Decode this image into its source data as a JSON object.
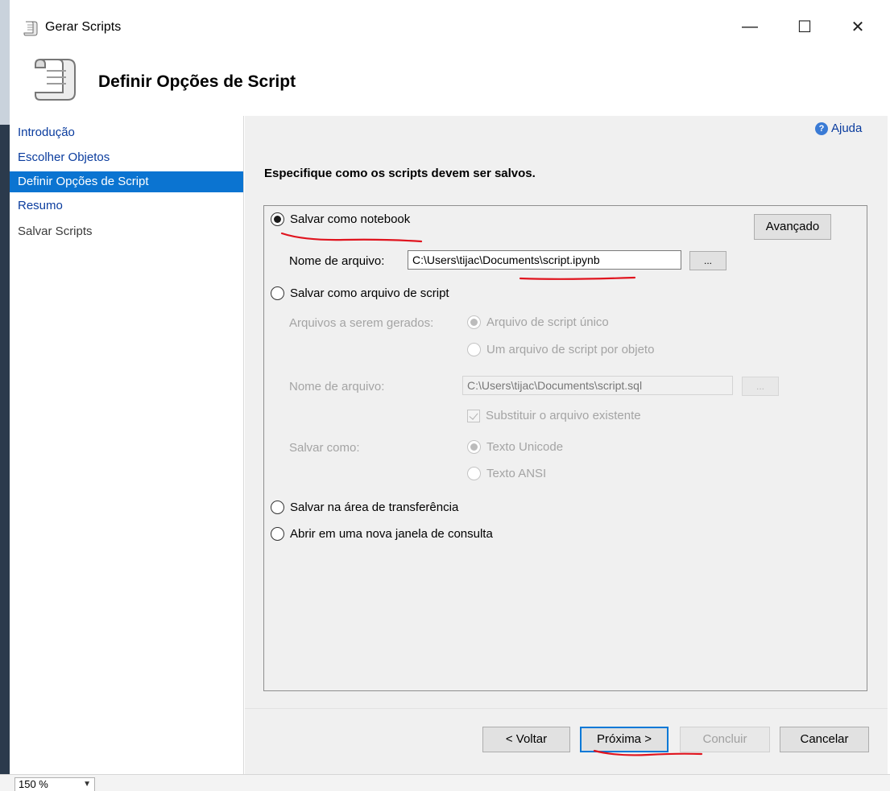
{
  "window": {
    "title": "Gerar Scripts",
    "icon": "scroll-icon",
    "controls": {
      "minimize": "—",
      "maximize": "☐",
      "close": "✕"
    }
  },
  "header": {
    "title": "Definir Opções de Script",
    "icon": "scroll-icon"
  },
  "nav": {
    "items": [
      {
        "label": "Introdução",
        "state": "link"
      },
      {
        "label": "Escolher Objetos",
        "state": "link"
      },
      {
        "label": "Definir Opções de Script",
        "state": "active"
      },
      {
        "label": "Resumo",
        "state": "link"
      },
      {
        "label": "Salvar Scripts",
        "state": "disabled"
      }
    ]
  },
  "help": {
    "label": "Ajuda",
    "icon": "help-icon"
  },
  "instruction": "Especifique como os scripts devem ser salvos.",
  "options": {
    "notebook": {
      "label": "Salvar como notebook",
      "checked": true,
      "filename_label": "Nome de arquivo:",
      "filename_value": "C:\\Users\\tijac\\Documents\\script.ipynb",
      "browse_label": "...",
      "advanced_label": "Avançado"
    },
    "script_file": {
      "label": "Salvar como arquivo de script",
      "checked": false,
      "files_label": "Arquivos a serem gerados:",
      "single_file": "Arquivo de script único",
      "per_object": "Um arquivo de script por objeto",
      "filename_label": "Nome de arquivo:",
      "filename_value": "C:\\Users\\tijac\\Documents\\script.sql",
      "browse_label": "...",
      "overwrite_label": "Substituir o arquivo existente",
      "save_as_label": "Salvar como:",
      "unicode": "Texto Unicode",
      "ansi": "Texto ANSI"
    },
    "clipboard": {
      "label": "Salvar na área de transferência",
      "checked": false
    },
    "new_query": {
      "label": "Abrir em uma nova janela de consulta",
      "checked": false
    }
  },
  "buttons": {
    "back": "< Voltar",
    "next": "Próxima >",
    "finish": "Concluir",
    "cancel": "Cancelar"
  },
  "status": {
    "zoom": "150 %"
  },
  "colors": {
    "accent": "#0b74d1",
    "link": "#0a3c9e",
    "annotation": "#e0141e"
  }
}
